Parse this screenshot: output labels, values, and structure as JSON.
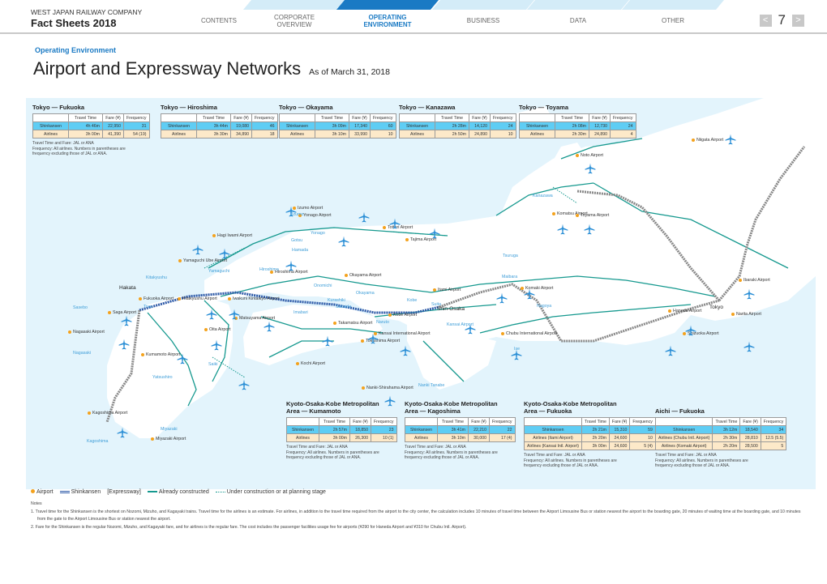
{
  "header": {
    "company": "WEST JAPAN RAILWAY COMPANY",
    "brand": "Fact Sheets 2018",
    "tabs": [
      {
        "line1": "CONTENTS",
        "line2": "",
        "active": false
      },
      {
        "line1": "CORPORATE",
        "line2": "OVERVIEW",
        "active": false
      },
      {
        "line1": "OPERATING",
        "line2": "ENVIRONMENT",
        "active": true
      },
      {
        "line1": "BUSINESS",
        "line2": "",
        "active": false
      },
      {
        "line1": "DATA",
        "line2": "",
        "active": false
      },
      {
        "line1": "OTHER",
        "line2": "",
        "active": false
      }
    ],
    "prev_icon": "chevron-left-icon",
    "next_icon": "chevron-right-icon",
    "prev_glyph": "<",
    "next_glyph": ">",
    "page_number": "7"
  },
  "page": {
    "section": "Operating Environment",
    "title": "Airport and Expressway Networks",
    "as_of": "As of March 31, 2018"
  },
  "table_headers": {
    "blank": "",
    "travel_time": "Travel Time",
    "fare": "Fare (¥)",
    "frequency": "Frequency"
  },
  "note_standard": {
    "line1": "Travel Time and Fare: JAL or ANA",
    "line2": "Frequency: All airlines. Numbers in parentheses are",
    "line3": "frequency excluding those of JAL or ANA."
  },
  "tables": [
    {
      "title1": "Tokyo — Fukuoka",
      "title2": "",
      "rows": [
        {
          "mode": "Shinkansen",
          "time": "4h 46m",
          "fare": "22,950",
          "freq": "31",
          "type": "shk"
        },
        {
          "mode": "Airlines",
          "time": "3h 00m",
          "fare": "41,390",
          "freq": "54 (19)",
          "type": "air"
        }
      ]
    },
    {
      "title1": "Tokyo — Hiroshima",
      "title2": "",
      "rows": [
        {
          "mode": "Shinkansen",
          "time": "3h 44m",
          "fare": "19,080",
          "freq": "46",
          "type": "shk"
        },
        {
          "mode": "Airlines",
          "time": "3h 30m",
          "fare": "34,890",
          "freq": "18",
          "type": "air"
        }
      ]
    },
    {
      "title1": "Tokyo — Okayama",
      "title2": "",
      "rows": [
        {
          "mode": "Shinkansen",
          "time": "3h 09m",
          "fare": "17,340",
          "freq": "60",
          "type": "shk"
        },
        {
          "mode": "Airlines",
          "time": "3h 10m",
          "fare": "33,990",
          "freq": "10",
          "type": "air"
        }
      ]
    },
    {
      "title1": "Tokyo — Kanazawa",
      "title2": "",
      "rows": [
        {
          "mode": "Shinkansen",
          "time": "2h 28m",
          "fare": "14,120",
          "freq": "24",
          "type": "shk"
        },
        {
          "mode": "Airlines",
          "time": "2h 50m",
          "fare": "24,890",
          "freq": "10",
          "type": "air"
        }
      ]
    },
    {
      "title1": "Tokyo — Toyama",
      "title2": "",
      "rows": [
        {
          "mode": "Shinkansen",
          "time": "2h 08m",
          "fare": "12,730",
          "freq": "24",
          "type": "shk"
        },
        {
          "mode": "Airlines",
          "time": "2h 30m",
          "fare": "24,890",
          "freq": "4",
          "type": "air"
        }
      ]
    },
    {
      "title1": "Kyoto-Osaka-Kobe Metropolitan",
      "title2": "Area — Kumamoto",
      "rows": [
        {
          "mode": "Shinkansen",
          "time": "2h 57m",
          "fare": "18,850",
          "freq": "23",
          "type": "shk"
        },
        {
          "mode": "Airlines",
          "time": "3h 00m",
          "fare": "26,300",
          "freq": "10 (1)",
          "type": "air"
        }
      ]
    },
    {
      "title1": "Kyoto-Osaka-Kobe Metropolitan",
      "title2": "Area — Kagoshima",
      "rows": [
        {
          "mode": "Shinkansen",
          "time": "3h 41m",
          "fare": "22,210",
          "freq": "22",
          "type": "shk"
        },
        {
          "mode": "Airlines",
          "time": "3h 10m",
          "fare": "30,000",
          "freq": "17 (4)",
          "type": "air"
        }
      ]
    },
    {
      "title1": "Kyoto-Osaka-Kobe Metropolitan",
      "title2": "Area — Fukuoka",
      "rows": [
        {
          "mode": "Shinkansen",
          "time": "2h 21m",
          "fare": "15,310",
          "freq": "59",
          "type": "shk"
        },
        {
          "mode": "Airlines (Itami Airport)",
          "time": "2h 20m",
          "fare": "24,600",
          "freq": "10",
          "type": "air"
        },
        {
          "mode": "Airlines (Kansai Intl. Airport)",
          "time": "3h 00m",
          "fare": "24,600",
          "freq": "5 (4)",
          "type": "air"
        }
      ]
    },
    {
      "title1": "",
      "title2": "Aichi — Fukuoka",
      "rows": [
        {
          "mode": "Shinkansen",
          "time": "3h 12m",
          "fare": "18,540",
          "freq": "34",
          "type": "shk"
        },
        {
          "mode": "Airlines (Chubu Intl. Airport)",
          "time": "2h 30m",
          "fare": "28,810",
          "freq": "12.5 (5.5)",
          "type": "air"
        },
        {
          "mode": "Airlines (Komaki Airport)",
          "time": "2h 20m",
          "fare": "28,500",
          "freq": "5",
          "type": "air"
        }
      ]
    }
  ],
  "map_labels": {
    "airports": [
      "Niigata Airport",
      "Noto Airport",
      "Komatsu Airport",
      "Toyama Airport",
      "Izumo Airport",
      "Yonago Airport",
      "Tottori Airport",
      "Hagi Iwami Airport",
      "Tajima Airport",
      "Yamaguchi Ube Airport",
      "Hiroshima Airport",
      "Okayama Airport",
      "Itami Airport",
      "Komaki Airport",
      "Ibaraki Airport",
      "Fukuoka Airport",
      "Kitakyushu Airport",
      "Iwakuni Kintaikyo Airport",
      "Kobe Airport",
      "Saga Airport",
      "Matsuyama Airport",
      "Takamatsu Airport",
      "Kansai International Airport",
      "Chubu International Airport",
      "Shizuoka Airport",
      "Haneda Airport",
      "Narita Airport",
      "Oita Airport",
      "Nagasaki Airport",
      "Tokushima Airport",
      "Kumamoto Airport",
      "Kochi Airport",
      "Nanki-Shirahama Airport",
      "Kagoshima Airport",
      "Miyazaki Airport"
    ],
    "cities": [
      "Kanazawa",
      "Izumo",
      "Yonago",
      "Gotsu",
      "Hamada",
      "Tsuruga",
      "Yamaguchi",
      "Hiroshima",
      "Kitakyushu",
      "Onomichi",
      "Maibara",
      "Okayama",
      "Kurashiki",
      "Kobe",
      "Suita",
      "Nagoya",
      "Sasebo",
      "Tosu",
      "Imabari",
      "Sakaide",
      "Naruto",
      "Kansai Airport",
      "Nagasaki",
      "Ise",
      "Saiki",
      "Yatsushiro",
      "Nanki Tanabe",
      "Miyazaki",
      "Kagoshima"
    ],
    "major": [
      "Hakata",
      "Shin-Osaka",
      "Tokyo"
    ]
  },
  "legend": {
    "airport": "Airport",
    "shinkansen": "Shinkansen",
    "expressway": "[Expressway]",
    "constructed": "Already constructed",
    "planned": "Under construction or at planning stage"
  },
  "notes": {
    "heading": "Notes",
    "items": [
      "1. Travel time for the Shinkansen is the shortest on Nozomi, Mizuho, and Kagayaki trains. Travel time for the airlines is an estimate. For airlines, in addition to the travel time required from the airport to the city center, the calculation includes 10 minutes of travel time between the Airport Limousine Bus or station nearest the airport to the boarding gate, 20 minutes of waiting time at the boarding gate, and 10 minutes from the gate to the Airport Limousine Bus or station nearest the airport.",
      "2. Fare for the Shinkansen is the regular Nozomi, Mizuho, and Kagayaki fare, and for airlines is the regular fare. The cost includes the passenger facilities usage fee for airports (¥290 for Haneda Airport and ¥310 for Chubu Intl. Airport)."
    ]
  },
  "colors": {
    "accent": "#1a7ac4",
    "sea": "#e3f4fc",
    "shinkansen_row": "#5fcdf4",
    "airline_row": "#fde9c9",
    "expressway": "#16998f",
    "airport_dot": "#f4a21c",
    "plane": "#2b8fd6"
  }
}
